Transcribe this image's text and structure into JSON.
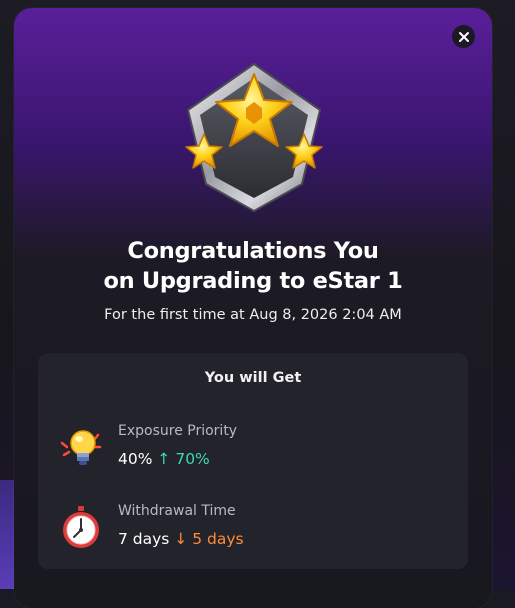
{
  "modal": {
    "title_line1": "Congratulations You",
    "title_line2": "on Upgrading to eStar 1",
    "subtitle": "For the first time at Aug 8, 2026 2:04 AM",
    "close_icon": "×"
  },
  "rewards": {
    "heading": "You will Get",
    "items": [
      {
        "label": "Exposure Priority",
        "old_value": "40%",
        "arrow": "↑",
        "new_value": "70%",
        "icon": "lightbulb-icon"
      },
      {
        "label": "Withdrawal Time",
        "old_value": "7 days",
        "arrow": "↓",
        "new_value": "5 days",
        "icon": "stopwatch-icon"
      }
    ]
  },
  "colors": {
    "accent_up": "#3ed7b1",
    "accent_down": "#ff8a3c",
    "modal_top": "#5a1f9a",
    "card_bg": "#23232c"
  }
}
